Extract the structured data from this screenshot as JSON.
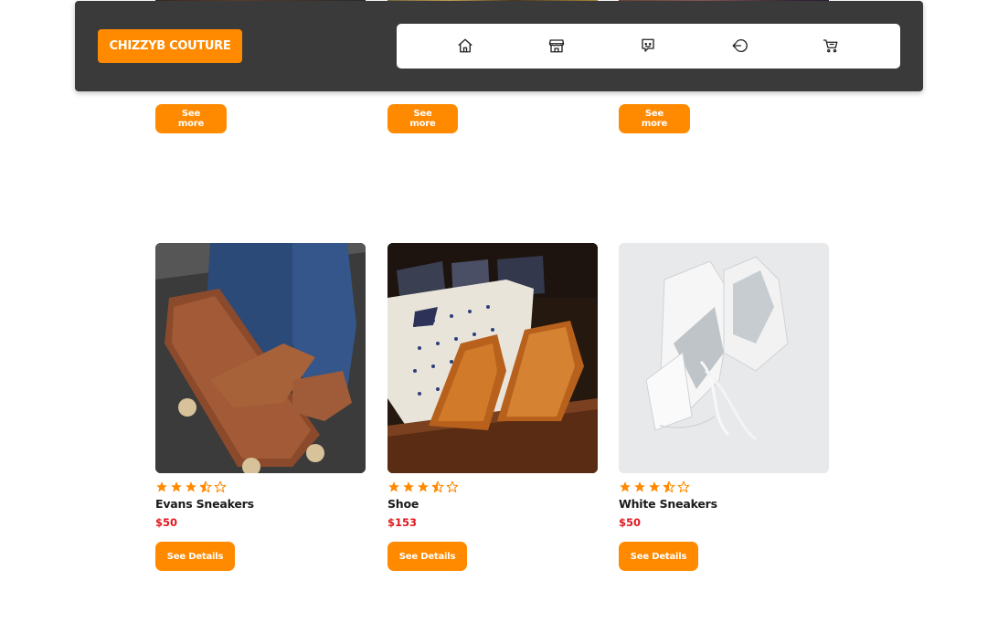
{
  "brand": {
    "name": "CHIZZYB COUTURE"
  },
  "nav": {
    "items": [
      {
        "icon": "home-icon"
      },
      {
        "icon": "store-icon"
      },
      {
        "icon": "chat-icon"
      },
      {
        "icon": "logout-icon"
      },
      {
        "icon": "cart-icon"
      }
    ]
  },
  "top_row": {
    "see_more_label": "See more"
  },
  "products": [
    {
      "name": "Evans Sneakers",
      "price": "$50",
      "rating": 3.5,
      "button_label": "See Details"
    },
    {
      "name": "Shoe",
      "price": "$153",
      "rating": 3.5,
      "button_label": "See Details"
    },
    {
      "name": "White Sneakers",
      "price": "$50",
      "rating": 3.5,
      "button_label": "See Details"
    }
  ],
  "colors": {
    "accent": "#ff8a00",
    "nav_bg": "#3a3a3a",
    "price": "#e0181e",
    "star": "#ff8a00"
  }
}
